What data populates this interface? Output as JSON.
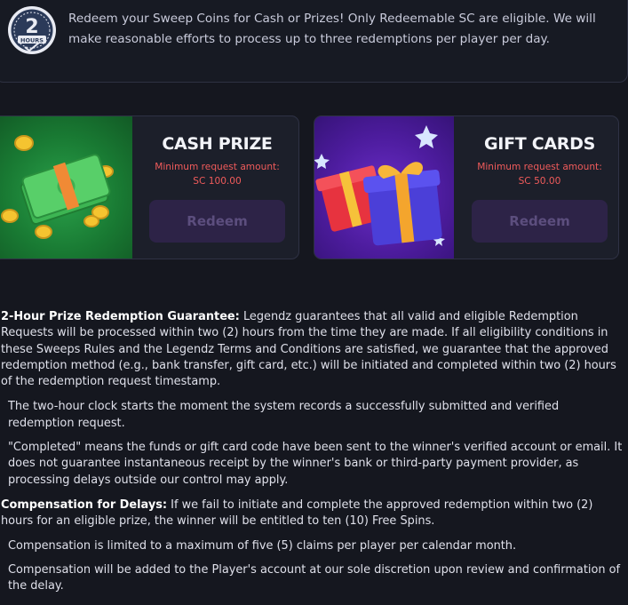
{
  "header": {
    "badge_number": "2",
    "badge_label": "HOURS",
    "message": "Redeem your Sweep Coins for Cash or Prizes! Only Redeemable SC are eligible. We will make reasonable efforts to process up to three redemptions per player per day."
  },
  "cards": [
    {
      "title": "CASH PRIZE",
      "min_label": "Minimum request amount:",
      "min_value": "SC 100.00",
      "button_label": "Redeem",
      "icon": "cash-stack-icon"
    },
    {
      "title": "GIFT CARDS",
      "min_label": "Minimum request amount:",
      "min_value": "SC 50.00",
      "button_label": "Redeem",
      "icon": "gift-box-icon"
    }
  ],
  "terms": {
    "guarantee_heading": "2-Hour Prize Redemption Guarantee:",
    "guarantee_text": " Legendz guarantees that all valid and eligible Redemption Requests will be processed within two (2) hours from the time they are made. If all eligibility conditions in these Sweeps Rules and the Legendz Terms and Conditions are satisfied, we guarantee that the approved redemption method (e.g., bank transfer, gift card, etc.) will be initiated and completed within two (2) hours of the redemption request timestamp.",
    "guarantee_points": [
      "The two-hour clock starts the moment the system records a successfully submitted and verified redemption request.",
      "\"Completed\" means the funds or gift card code have been sent to the winner's verified account or email. It does not guarantee instantaneous receipt by the winner's bank or third-party payment provider, as processing delays outside our control may apply."
    ],
    "compensation_heading": "Compensation for Delays:",
    "compensation_text": " If we fail to initiate and complete the approved redemption within two (2) hours for an eligible prize, the winner will be entitled to ten (10) Free Spins.",
    "compensation_points": [
      "Compensation is limited to a maximum of five (5) claims per player per calendar month.",
      "Compensation will be added to the Player's account at our sole discretion upon review and confirmation of the delay."
    ]
  },
  "colors": {
    "background": "#15171f",
    "accent_red": "#f05b5b",
    "button_bg": "#2d2347",
    "button_text": "#5c4e7e"
  }
}
